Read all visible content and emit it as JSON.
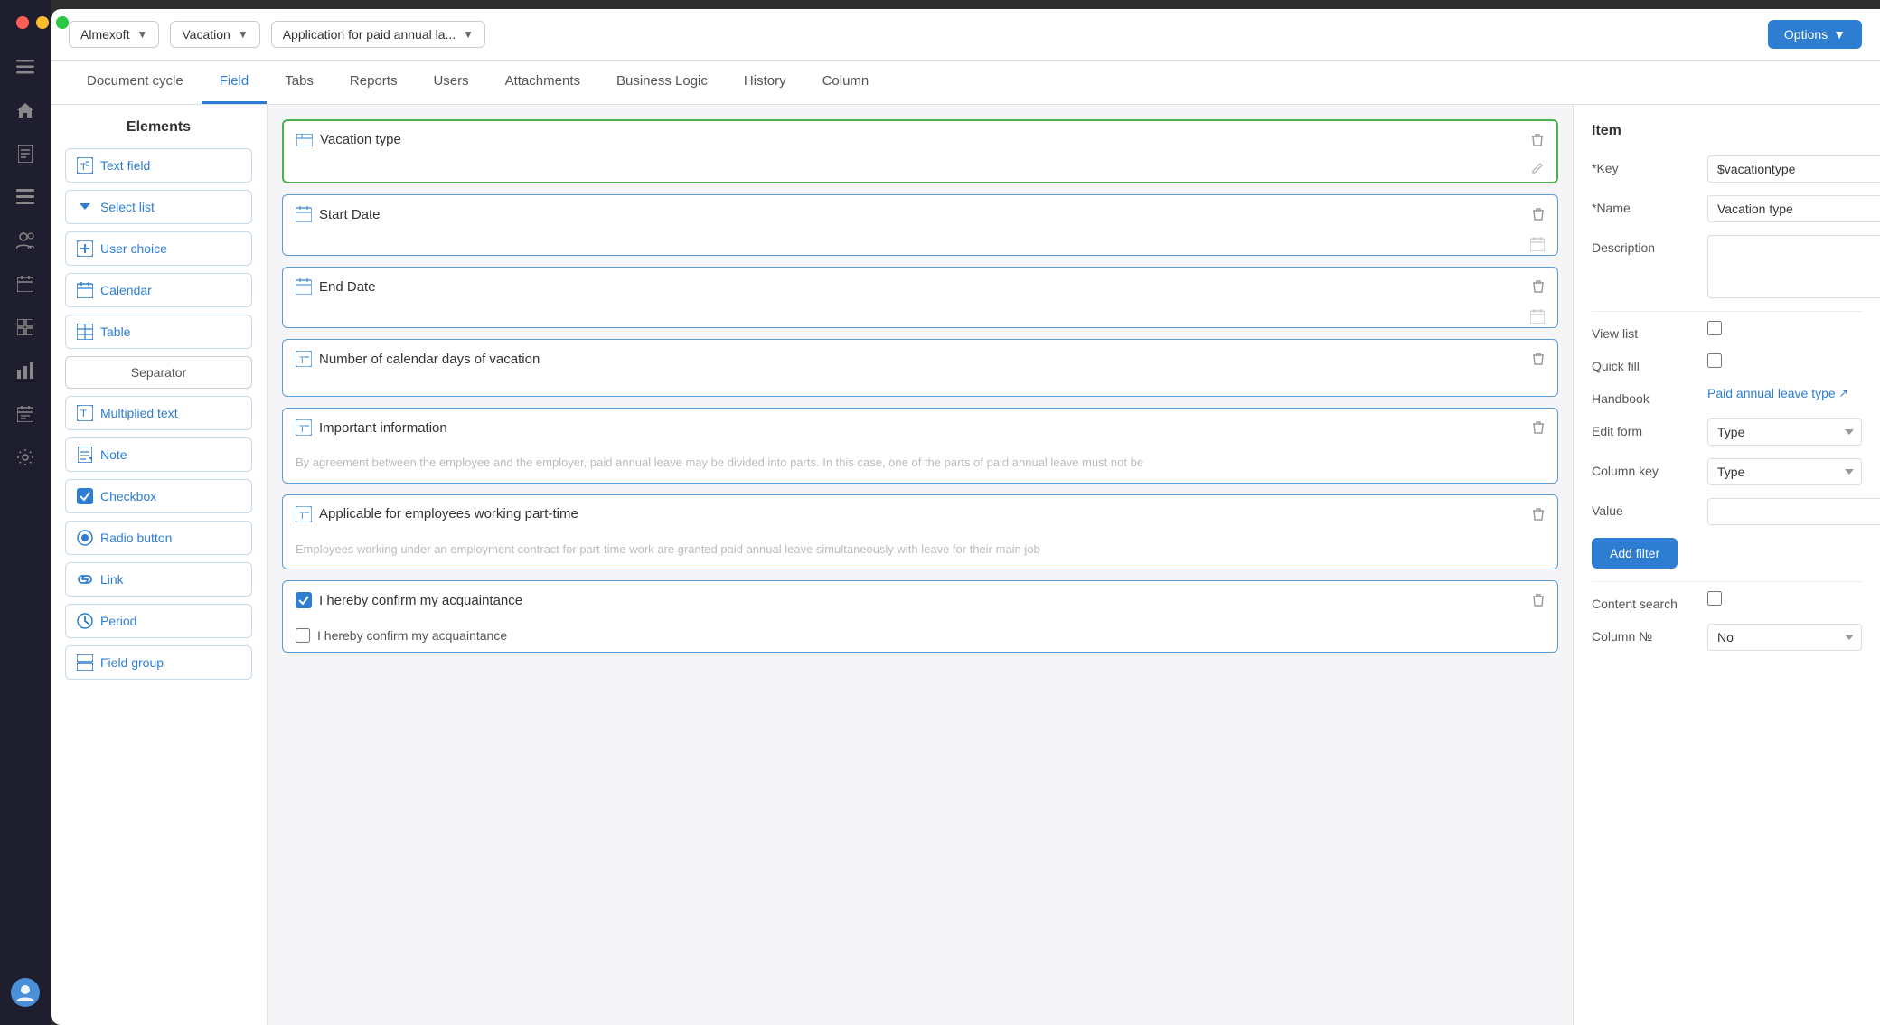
{
  "window": {
    "dots": [
      "red",
      "yellow",
      "green"
    ]
  },
  "topbar": {
    "org": "Almexoft",
    "app": "Vacation",
    "document": "Application for paid annual la...",
    "options_label": "Options"
  },
  "nav_tabs": [
    {
      "id": "document-cycle",
      "label": "Document cycle",
      "active": false
    },
    {
      "id": "field",
      "label": "Field",
      "active": true
    },
    {
      "id": "tabs",
      "label": "Tabs",
      "active": false
    },
    {
      "id": "reports",
      "label": "Reports",
      "active": false
    },
    {
      "id": "users",
      "label": "Users",
      "active": false
    },
    {
      "id": "attachments",
      "label": "Attachments",
      "active": false
    },
    {
      "id": "business-logic",
      "label": "Business Logic",
      "active": false
    },
    {
      "id": "history",
      "label": "History",
      "active": false
    },
    {
      "id": "column",
      "label": "Column",
      "active": false
    }
  ],
  "elements_panel": {
    "title": "Elements",
    "items": [
      {
        "id": "text-field",
        "label": "Text field",
        "icon": "text"
      },
      {
        "id": "select-list",
        "label": "Select list",
        "icon": "dropdown"
      },
      {
        "id": "user-choice",
        "label": "User choice",
        "icon": "plus-box"
      },
      {
        "id": "calendar",
        "label": "Calendar",
        "icon": "calendar"
      },
      {
        "id": "table",
        "label": "Table",
        "icon": "table"
      },
      {
        "id": "separator",
        "label": "Separator",
        "icon": null
      },
      {
        "id": "multiplied-text",
        "label": "Multiplied text",
        "icon": "text"
      },
      {
        "id": "note",
        "label": "Note",
        "icon": "note"
      },
      {
        "id": "checkbox",
        "label": "Checkbox",
        "icon": "checkbox"
      },
      {
        "id": "radio-button",
        "label": "Radio button",
        "icon": "radio"
      },
      {
        "id": "link",
        "label": "Link",
        "icon": "link"
      },
      {
        "id": "period",
        "label": "Period",
        "icon": "clock"
      },
      {
        "id": "field-group",
        "label": "Field group",
        "icon": "group"
      }
    ]
  },
  "fields": [
    {
      "id": "vacation-type",
      "title": "Vacation type",
      "selected": true,
      "icon": "select",
      "placeholder": null,
      "body_type": "empty"
    },
    {
      "id": "start-date",
      "title": "Start Date",
      "selected": false,
      "icon": "calendar",
      "placeholder": null,
      "body_type": "calendar-icon"
    },
    {
      "id": "end-date",
      "title": "End Date",
      "selected": false,
      "icon": "calendar",
      "placeholder": null,
      "body_type": "calendar-icon"
    },
    {
      "id": "num-calendar-days",
      "title": "Number of calendar days of vacation",
      "selected": false,
      "icon": "text-plus",
      "placeholder": null,
      "body_type": "empty"
    },
    {
      "id": "important-info",
      "title": "Important information",
      "selected": false,
      "icon": "text-plus",
      "placeholder": "By agreement between the employee and the employer, paid annual leave may be divided into parts. In this case, one of the parts of paid annual leave must not be",
      "body_type": "text"
    },
    {
      "id": "applicable-parttime",
      "title": "Applicable for employees working part-time",
      "selected": false,
      "icon": "text-plus",
      "placeholder": "Employees working under an employment contract for part-time work are granted paid annual leave simultaneously with leave for their main job",
      "body_type": "text"
    },
    {
      "id": "confirm-acquaintance",
      "title": "I hereby confirm my acquaintance",
      "selected": false,
      "icon": "checkbox",
      "body_type": "checkbox",
      "checkbox_label": "I hereby confirm my acquaintance"
    }
  ],
  "properties": {
    "section_title": "Item",
    "key_label": "*Key",
    "key_value": "$vacationtype",
    "name_label": "*Name",
    "name_value": "Vacation type",
    "description_label": "Description",
    "description_value": "",
    "view_list_label": "View list",
    "quick_fill_label": "Quick fill",
    "handbook_label": "Handbook",
    "handbook_value": "Paid annual leave type",
    "edit_form_label": "Edit form",
    "edit_form_value": "Type",
    "column_key_label": "Column key",
    "column_key_value": "Type",
    "value_label": "Value",
    "value_value": "",
    "add_filter_label": "Add filter",
    "content_search_label": "Content search",
    "column_no_label": "Column №",
    "column_no_value": "No"
  },
  "sidebar_icons": [
    {
      "id": "menu",
      "symbol": "☰"
    },
    {
      "id": "home",
      "symbol": "⌂"
    },
    {
      "id": "doc",
      "symbol": "📄"
    },
    {
      "id": "list",
      "symbol": "☰"
    },
    {
      "id": "users",
      "symbol": "👥"
    },
    {
      "id": "calendar",
      "symbol": "📅"
    },
    {
      "id": "table2",
      "symbol": "⊞"
    },
    {
      "id": "chart",
      "symbol": "📊"
    },
    {
      "id": "cal2",
      "symbol": "🗓"
    },
    {
      "id": "settings",
      "symbol": "⚙"
    }
  ]
}
